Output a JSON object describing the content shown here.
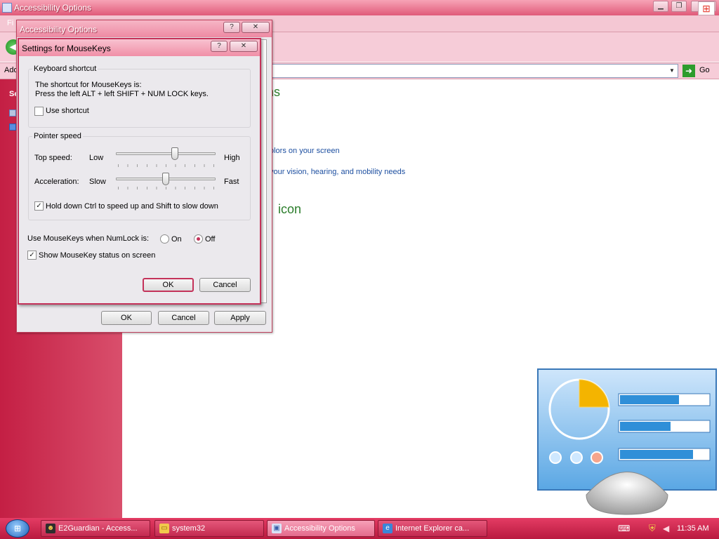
{
  "main_window": {
    "title": "Accessibility Options",
    "menu_partial": "Fi",
    "address_label_partial": "Add",
    "go_label": "Go",
    "sidebar_heading_partial": "Se",
    "heading_partial": "ns",
    "links_partial": [
      "olors on your screen",
      "your vision, hearing, and mobility needs"
    ],
    "section_heading_partial": "icon"
  },
  "accessibility_dialog": {
    "title": "Accessibility Options",
    "buttons": {
      "ok": "OK",
      "cancel": "Cancel",
      "apply": "Apply"
    }
  },
  "mousekeys_dialog": {
    "title": "Settings for MouseKeys",
    "keyboard_shortcut": {
      "legend": "Keyboard shortcut",
      "line1": "The shortcut for MouseKeys is:",
      "line2": "Press the left ALT + left SHIFT + NUM LOCK keys.",
      "use_shortcut_label": "Use shortcut",
      "use_shortcut_checked": false
    },
    "pointer_speed": {
      "legend": "Pointer speed",
      "top_speed": {
        "label": "Top speed:",
        "min": "Low",
        "max": "High",
        "value": 0.6
      },
      "acceleration": {
        "label": "Acceleration:",
        "min": "Slow",
        "max": "Fast",
        "value": 0.5
      },
      "ctrl_shift_label": "Hold down Ctrl to speed up and Shift to slow down",
      "ctrl_shift_checked": true
    },
    "numlock": {
      "label": "Use MouseKeys when NumLock is:",
      "on_label": "On",
      "off_label": "Off",
      "selected": "Off"
    },
    "status": {
      "label": "Show MouseKey status on screen",
      "checked": true
    },
    "buttons": {
      "ok": "OK",
      "cancel": "Cancel"
    }
  },
  "taskbar": {
    "items": [
      {
        "label": "E2Guardian - Access...",
        "icon": "e2guardian-icon"
      },
      {
        "label": "system32",
        "icon": "folder-icon"
      },
      {
        "label": "Accessibility Options",
        "icon": "control-panel-icon",
        "active": true
      },
      {
        "label": "Internet Explorer ca...",
        "icon": "ie-icon"
      }
    ],
    "clock": "11:35 AM"
  },
  "colors": {
    "accent": "#c4325a",
    "taskbar": "#d42c54",
    "link": "#1d4fa0",
    "heading_green": "#2b7d2b"
  }
}
